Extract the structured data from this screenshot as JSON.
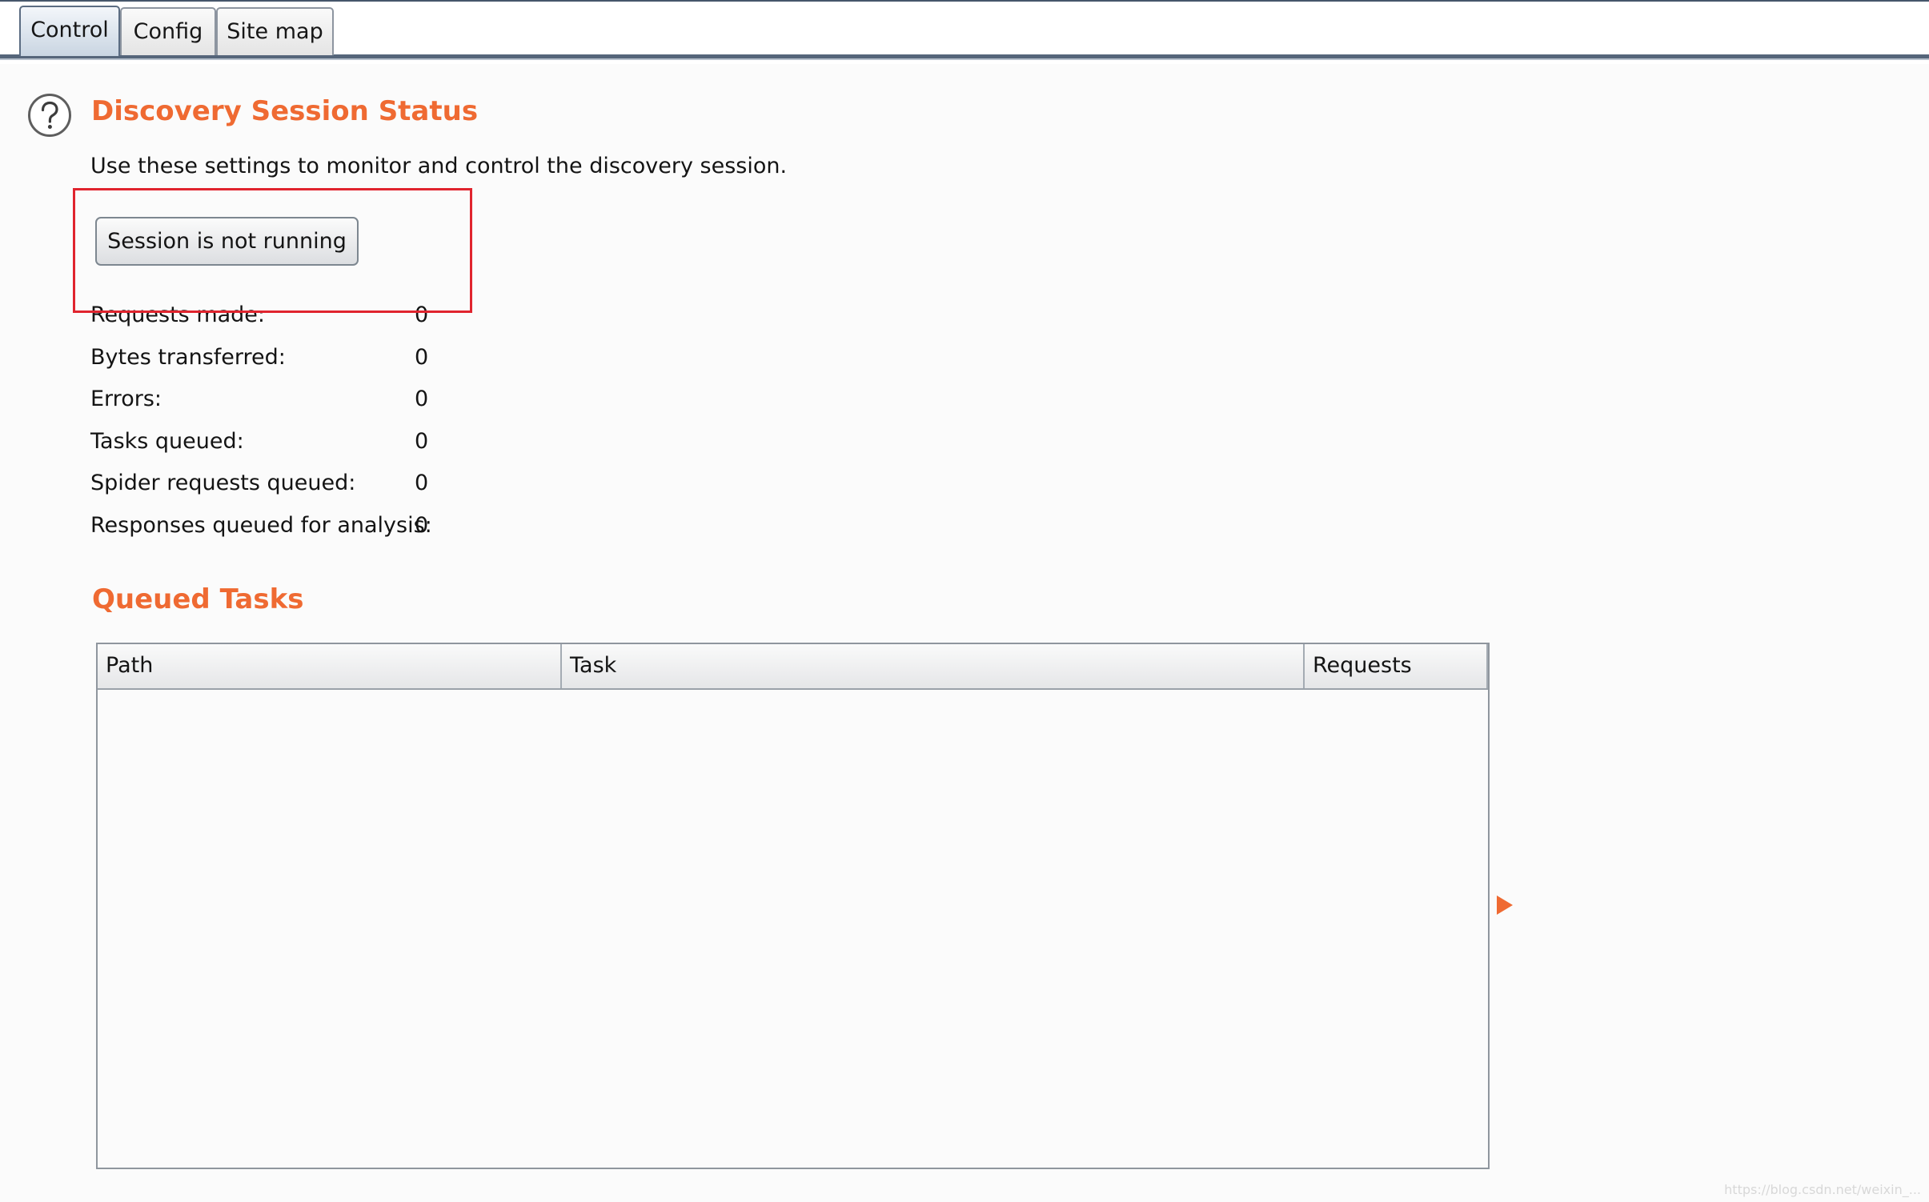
{
  "tabs": [
    {
      "label": "Control",
      "active": true
    },
    {
      "label": "Config",
      "active": false
    },
    {
      "label": "Site map",
      "active": false
    }
  ],
  "status_section": {
    "title": "Discovery Session Status",
    "description": "Use these settings to monitor and control the discovery session.",
    "session_button_label": "Session is not running",
    "help_icon": "question-circle-icon",
    "stats": [
      {
        "label": "Requests made:",
        "value": "0"
      },
      {
        "label": "Bytes transferred:",
        "value": "0"
      },
      {
        "label": "Errors:",
        "value": "0"
      },
      {
        "label": "Tasks queued:",
        "value": "0"
      },
      {
        "label": "Spider requests queued:",
        "value": "0"
      },
      {
        "label": "Responses queued for analysis:",
        "value": "0"
      }
    ]
  },
  "queued_tasks": {
    "title": "Queued Tasks",
    "columns": [
      "Path",
      "Task",
      "Requests"
    ],
    "rows": []
  },
  "watermark": "https://blog.csdn.net/weixin_...",
  "colors": {
    "accent": "#ef6a32",
    "highlight_box": "#e0242e",
    "tab_rule": "#55657a"
  }
}
